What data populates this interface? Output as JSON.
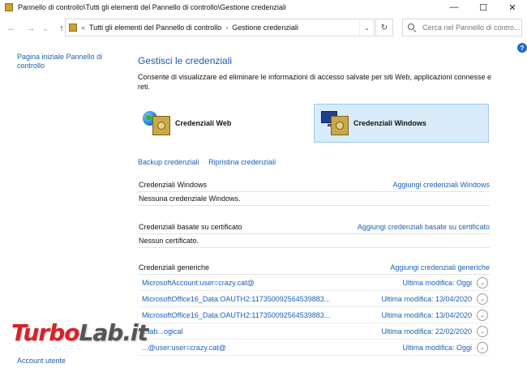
{
  "window": {
    "title": "Pannello di controllo\\Tutti gli elementi del Pannello di controllo\\Gestione credenziali",
    "minimize": "—",
    "maximize": "☐",
    "close": "✕"
  },
  "address": {
    "overflow": "«",
    "crumb1": "Tutti gli elementi del Pannello di controllo",
    "separator": "›",
    "crumb2": "Gestione credenziali",
    "search_placeholder": "Cerca nel Pannello di contro..."
  },
  "sidebar": {
    "home_link": "Pagina iniziale Pannello di controllo",
    "account_link": "Account utente"
  },
  "main": {
    "heading": "Gestisci le credenziali",
    "description": "Consente di visualizzare ed eliminare le informazioni di accesso salvate per siti Web, applicazioni connesse e reti.",
    "tile_web": "Credenziali Web",
    "tile_windows": "Credenziali Windows",
    "backup": "Backup credenziali",
    "restore": "Ripristina credenziali"
  },
  "sections": {
    "windows": {
      "title": "Credenziali Windows",
      "action": "Aggiungi credenziali Windows",
      "empty": "Nessuna credenziale Windows."
    },
    "certificate": {
      "title": "Credenziali basate su certificato",
      "action": "Aggiungi credenziali basate su certificato",
      "empty": "Nessun certificato."
    },
    "generic": {
      "title": "Credenziali generiche",
      "action": "Aggiungi credenziali generiche",
      "rows": [
        {
          "name": "MicrosoftAccount:user=crazy.cat@",
          "modified": "Ultima modifica:  Oggi"
        },
        {
          "name": "MicrosoftOffice16_Data:OAUTH2:117350092564539883...",
          "modified": "Ultima modifica:  13/04/2020"
        },
        {
          "name": "MicrosoftOffice16_Data:OAUTH2:117350092564539883...",
          "modified": "Ultima modifica:  13/04/2020"
        },
        {
          "name": "...lab...ogical",
          "modified": "Ultima modifica:  22/02/2020"
        },
        {
          "name": "...@user:user=crazy.cat@",
          "modified": "Ultima modifica:  Oggi"
        }
      ]
    }
  },
  "watermark": {
    "part1": "Turbo",
    "part2": "Lab.it"
  },
  "colors": {
    "link": "#1a5fb4",
    "heading": "#1c58b5",
    "selected_tile": "#d8ebfb"
  }
}
